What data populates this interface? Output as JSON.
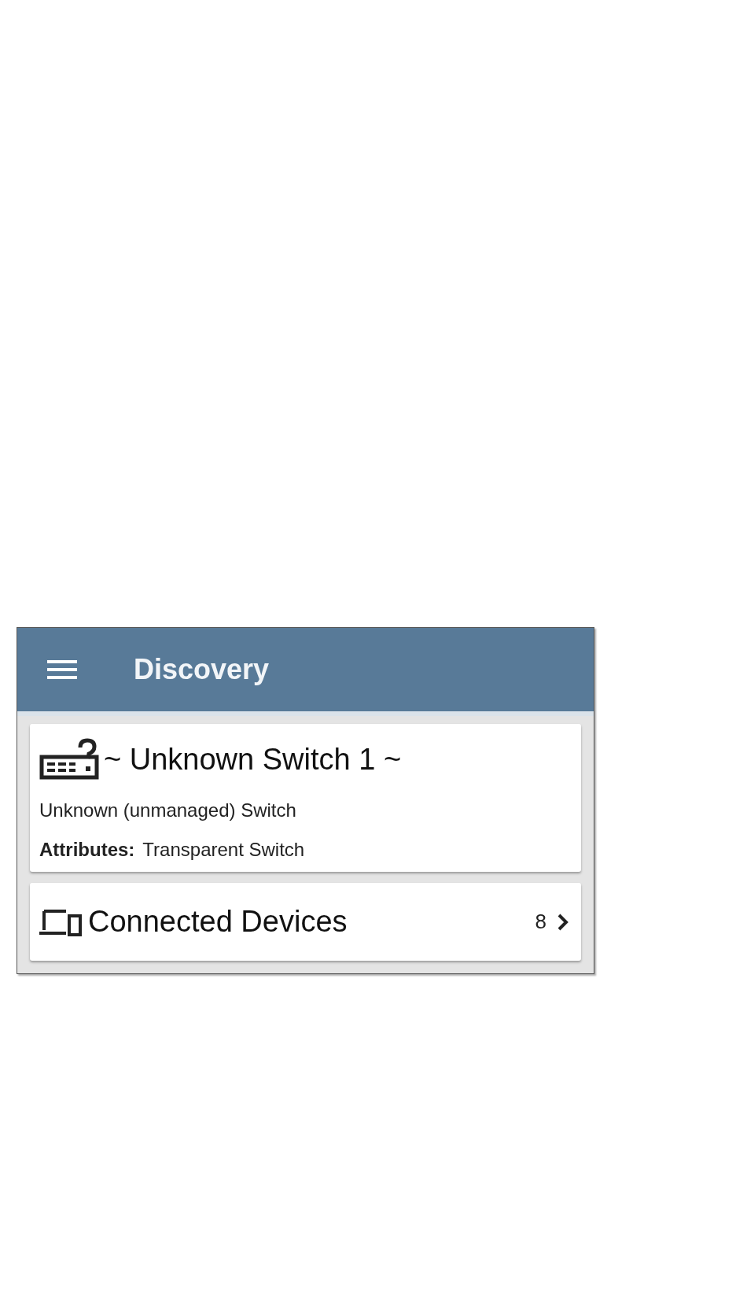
{
  "app_bar": {
    "title": "Discovery"
  },
  "device_card": {
    "title": "~ Unknown Switch 1 ~",
    "type": "Unknown (unmanaged) Switch",
    "attributes_label": "Attributes:",
    "attributes_value": "Transparent Switch"
  },
  "connected_devices": {
    "label": "Connected Devices",
    "count": "8"
  }
}
